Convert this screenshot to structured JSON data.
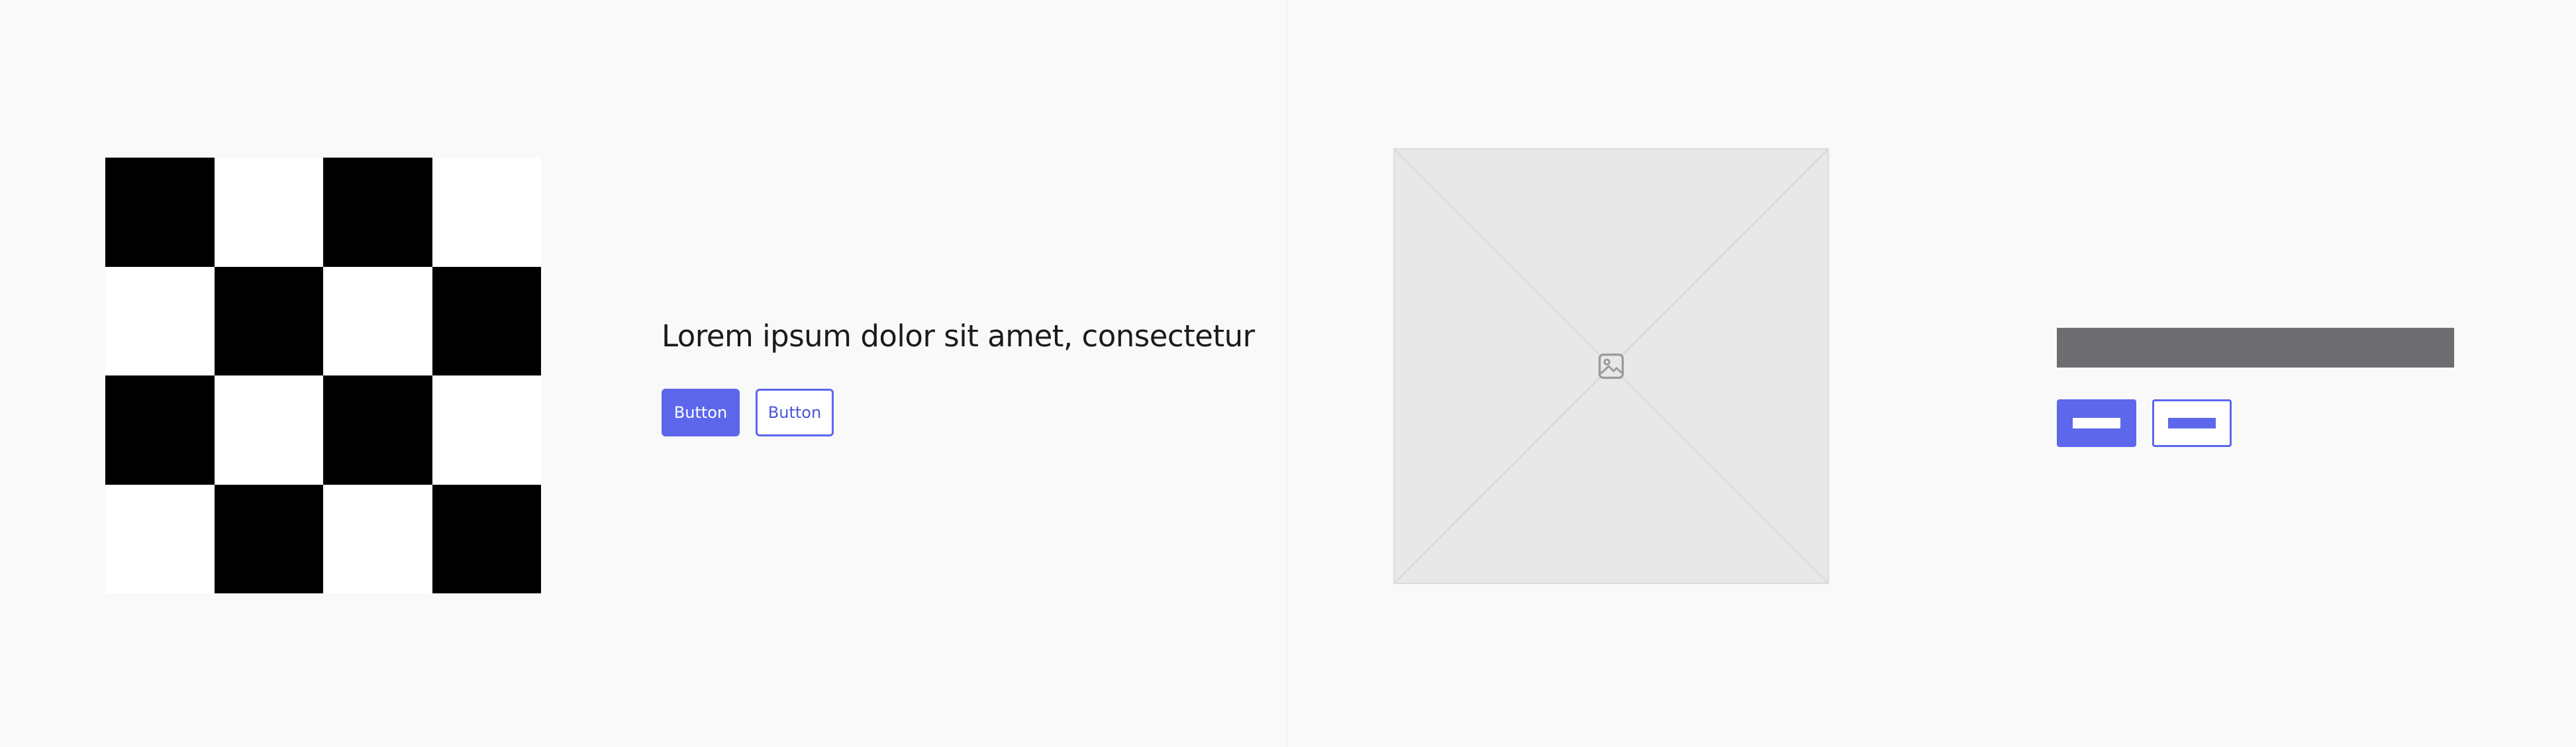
{
  "left_panel": {
    "headline": "Lorem ipsum dolor sit amet, consectetur",
    "primary_button_label": "Button",
    "secondary_button_label": "Button"
  },
  "right_panel": {
    "image_icon": "image-icon"
  },
  "colors": {
    "accent": "#5c67ec",
    "background": "#f9f9f9",
    "placeholder": "#e8e8e8",
    "text_bar": "#6e6d72",
    "checker_dark": "#000000",
    "checker_light": "#ffffff"
  }
}
